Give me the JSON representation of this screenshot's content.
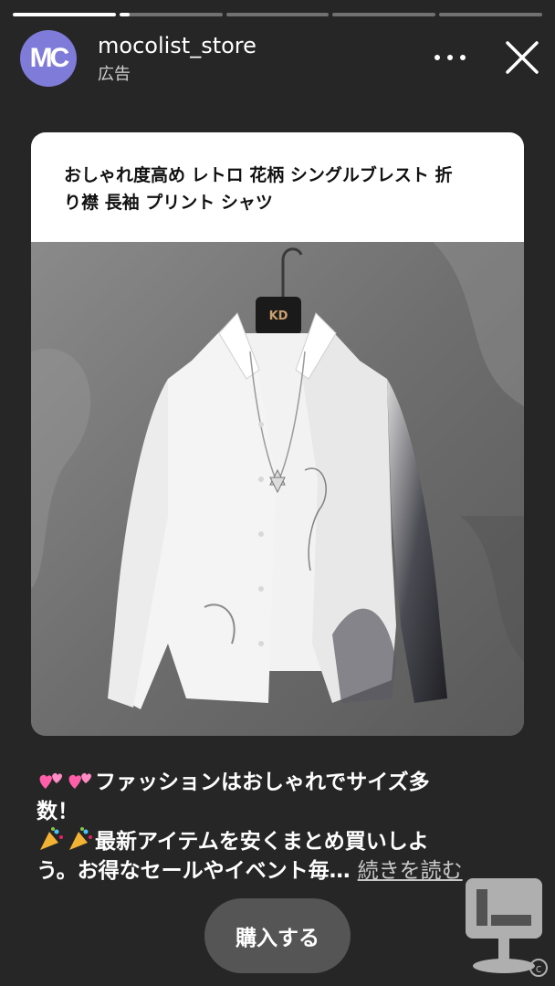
{
  "progress": [
    1.0,
    0.1,
    0.0,
    0.0,
    0.0
  ],
  "header": {
    "avatar_text": "MC",
    "username": "mocolist_store",
    "sponsored_label": "広告",
    "more_icon": "more-horizontal-icon",
    "close_icon": "close-icon"
  },
  "product": {
    "title_line1": "おしゃれ度高め レトロ 花柄 シングルブレスト 折",
    "title_line2": "り襟 長袖 プリント シャツ",
    "hanger_tag": "KD"
  },
  "caption": {
    "line1_text": "ファッションはおしゃれでサイズ多",
    "line2_text": "数！",
    "line3_text": "最新アイテムを安くまとめ買いしよ",
    "line4_text": "う。お得なセールやイベント毎…",
    "more_link": "続きを読む",
    "emoji1": "sparkling-hearts-icon",
    "emoji2": "party-popper-icon"
  },
  "cta": {
    "buy_label": "購入する"
  },
  "colors": {
    "background": "#262626",
    "avatar": "#7f7bd8",
    "button": "#555555"
  }
}
